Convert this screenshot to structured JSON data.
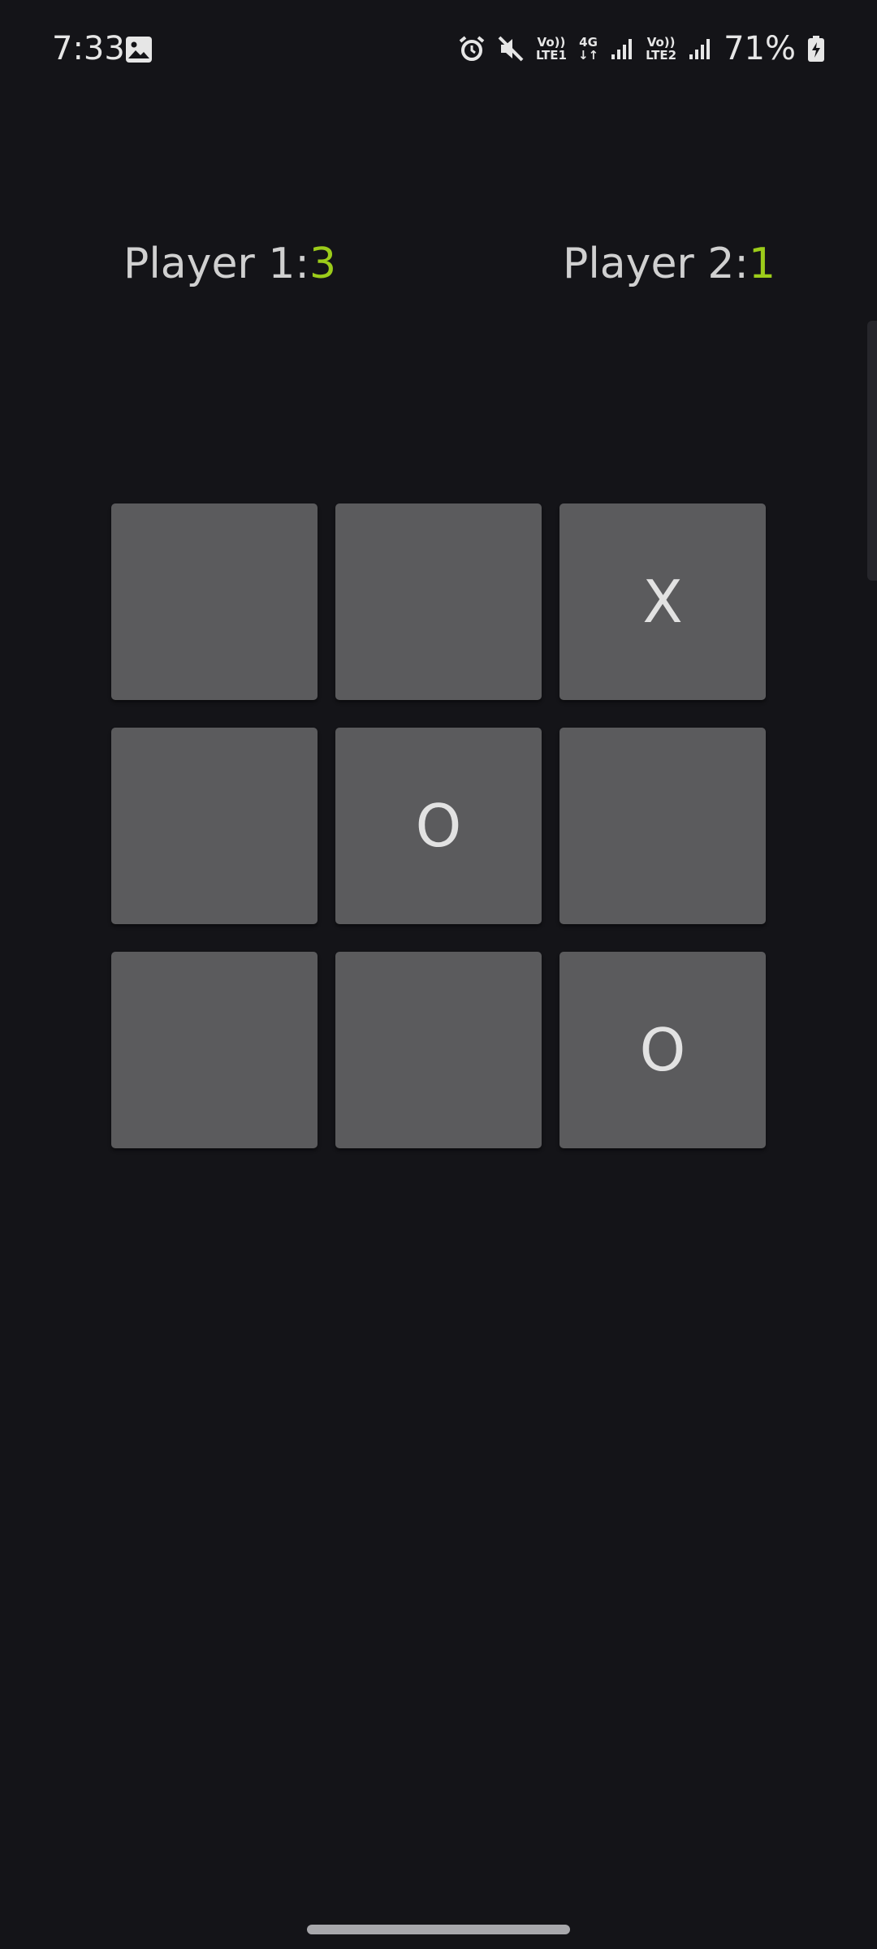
{
  "status_bar": {
    "time": "7:33",
    "battery_percent": "71%",
    "network_4g": "4G",
    "lte1_top": "Vo))",
    "lte1_bottom": "LTE1",
    "lte2_top": "Vo))",
    "lte2_bottom": "LTE2",
    "icons": [
      "gallery-icon",
      "alarm-icon",
      "mute-icon",
      "signal-icon",
      "battery-charging-icon"
    ]
  },
  "scores": {
    "player1_label": "Player 1:",
    "player1_score": "3",
    "player2_label": "Player 2:",
    "player2_score": "1"
  },
  "board": {
    "cells": [
      "",
      "",
      "X",
      "",
      "O",
      "",
      "",
      "",
      "O"
    ]
  },
  "colors": {
    "background": "#141418",
    "cell": "#5b5b5d",
    "score_accent": "#9ccc1a"
  }
}
